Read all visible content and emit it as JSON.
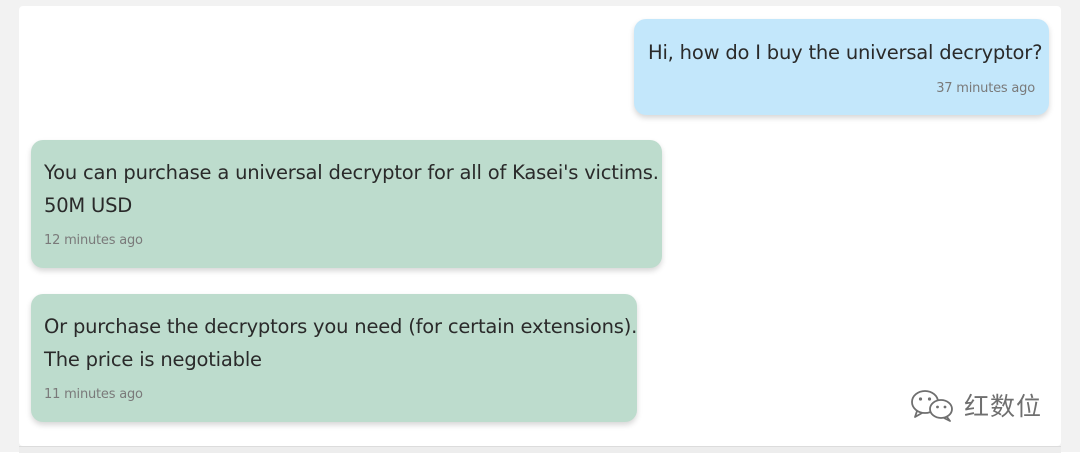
{
  "chat": {
    "messages": [
      {
        "direction": "outgoing",
        "lines": [
          "Hi, how do I buy the universal decryptor?"
        ],
        "time": "37 minutes ago"
      },
      {
        "direction": "incoming",
        "lines": [
          "You can purchase a universal decryptor for all of Kasei's victims.",
          "50M USD"
        ],
        "time": "12 minutes ago"
      },
      {
        "direction": "incoming",
        "lines": [
          "Or purchase the decryptors you need (for certain extensions).",
          "The price is negotiable"
        ],
        "time": "11 minutes ago"
      }
    ]
  },
  "watermark": {
    "icon": "wechat-icon",
    "text": "红数位"
  },
  "colors": {
    "outgoing_bubble": "#c3e7fb",
    "incoming_bubble": "#bddccd",
    "background": "#ffffff"
  }
}
